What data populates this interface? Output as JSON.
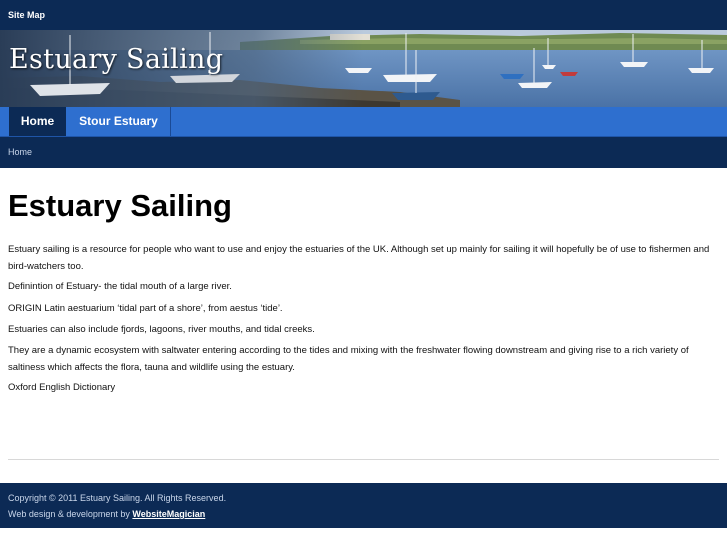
{
  "topbar": {
    "sitemap_label": "Site Map"
  },
  "banner": {
    "title": "Estuary Sailing"
  },
  "nav": {
    "tabs": [
      {
        "label": "Home"
      },
      {
        "label": "Stour Estuary"
      }
    ]
  },
  "breadcrumb": {
    "current": "Home"
  },
  "main": {
    "heading": "Estuary Sailing",
    "paragraphs": [
      "Estuary sailing is a resource for people who want to use and enjoy the estuaries of the UK.  Although set up mainly for sailing it will hopefully be of use to fishermen and bird-watchers too.",
      "Definintion of Estuary- the tidal mouth of a large river.",
      "ORIGIN Latin aestuarium ‘tidal part of a shore’, from aestus ‘tide’.",
      "Estuaries can also include fjords, lagoons, river mouths, and tidal creeks.",
      "They are a dynamic ecosystem with saltwater entering according to the tides and mixing with the freshwater flowing downstream and giving rise to a rich variety of saltiness which affects the flora, tauna and wildlife using the estuary.",
      "Oxford English Dictionary"
    ]
  },
  "footer": {
    "copyright": "Copyright © 2011 Estuary Sailing. All Rights Reserved.",
    "credit_prefix": "Web design & development by ",
    "credit_link": "WebsiteMagician"
  },
  "colors": {
    "dark_navy": "#0c2a55",
    "nav_blue": "#2e6fcf",
    "water": "#5d86b8"
  }
}
